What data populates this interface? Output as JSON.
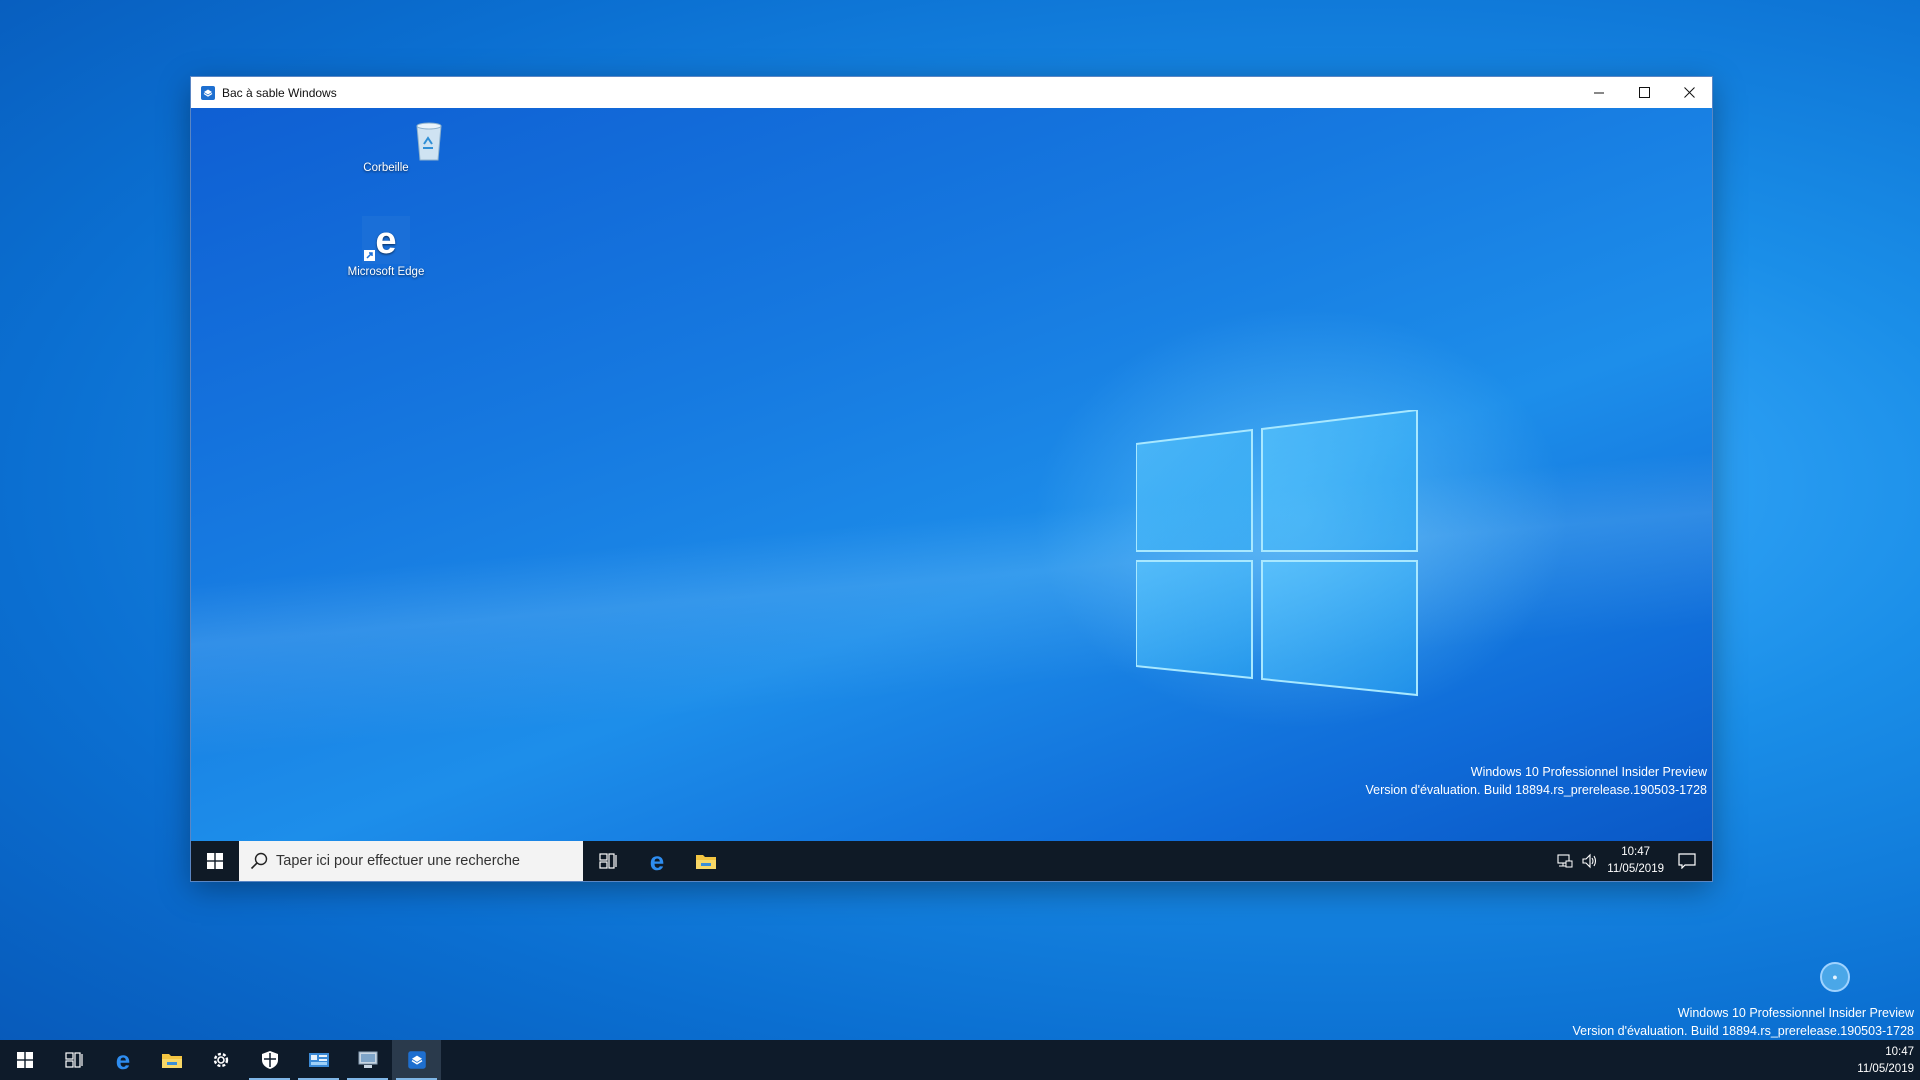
{
  "window": {
    "title": "Bac à sable Windows",
    "controls": {
      "minimize": "minimize-icon",
      "maximize": "maximize-icon",
      "close": "close-icon"
    }
  },
  "sandbox": {
    "desktop_icons": [
      {
        "label": "Corbeille",
        "icon": "recycle-bin-icon"
      },
      {
        "label": "Microsoft Edge",
        "icon": "edge-icon"
      }
    ],
    "watermark": {
      "line1": "Windows 10 Professionnel Insider Preview",
      "line2": "Version d'évaluation. Build 18894.rs_prerelease.190503-1728"
    },
    "taskbar": {
      "search_placeholder": "Taper ici pour effectuer une recherche",
      "apps": [
        "task-view-icon",
        "edge-icon",
        "file-explorer-icon"
      ],
      "tray_icons": [
        "network-icon",
        "volume-icon",
        "action-center-icon"
      ],
      "time": "10:47",
      "date": "11/05/2019"
    }
  },
  "host": {
    "watermark": {
      "line1": "Windows 10 Professionnel Insider Preview",
      "line2": "Version d'évaluation. Build 18894.rs_prerelease.190503-1728"
    },
    "taskbar": {
      "apps": [
        "start-icon",
        "task-view-icon",
        "edge-icon",
        "file-explorer-icon",
        "settings-icon",
        "windows-security-icon",
        "control-panel-icon",
        "remote-desktop-icon",
        "windows-sandbox-icon"
      ],
      "time": "10:47",
      "date": "11/05/2019"
    }
  },
  "colors": {
    "accent": "#0a63d3",
    "taskbar": "#0e1b2a",
    "titlebar": "#ffffff"
  }
}
